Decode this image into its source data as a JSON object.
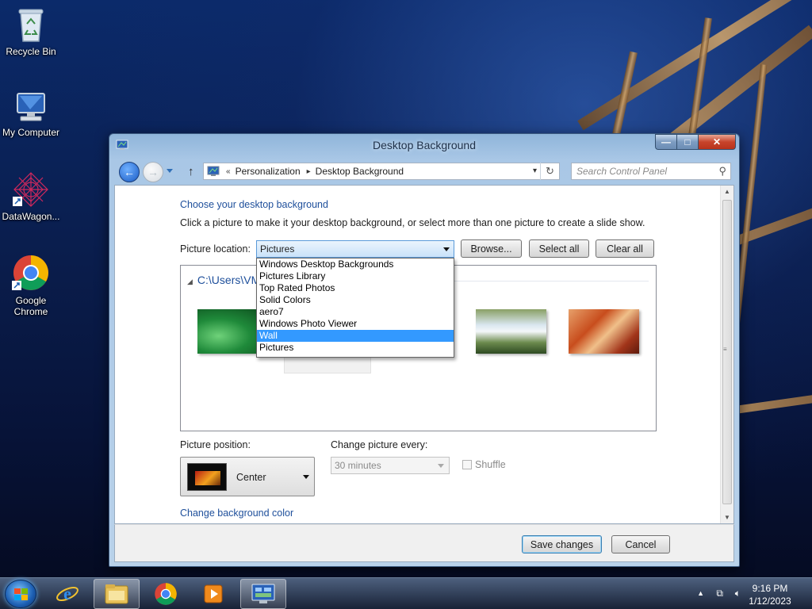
{
  "desktop": {
    "icons": [
      {
        "label": "Recycle Bin"
      },
      {
        "label": "My Computer"
      },
      {
        "label": "DataWagon..."
      },
      {
        "label": "Google Chrome"
      }
    ]
  },
  "window": {
    "title": "Desktop Background",
    "caption_buttons": {
      "minimize": "—",
      "maximize": "□",
      "close": "✕"
    },
    "nav": {
      "back": "←",
      "forward": "→",
      "up": "↑",
      "breadcrumb_prefix": "«",
      "breadcrumbs": [
        "Personalization",
        "Desktop Background"
      ],
      "search_placeholder": "Search Control Panel"
    },
    "content": {
      "heading": "Choose your desktop background",
      "instruction": "Click a picture to make it your desktop background, or select more than one picture to create a slide show.",
      "picture_location_label": "Picture location:",
      "picture_location_value": "Pictures",
      "browse_label": "Browse...",
      "select_all_label": "Select all",
      "clear_all_label": "Clear all",
      "group_path": "C:\\Users\\VM",
      "dropdown_options": [
        "Windows Desktop Backgrounds",
        "Pictures Library",
        "Top Rated Photos",
        "Solid Colors",
        "aero7",
        "Windows Photo Viewer",
        "Wall",
        "Pictures"
      ],
      "highlighted_option": "Wall",
      "picture_position_label": "Picture position:",
      "picture_position_value": "Center",
      "change_every_label": "Change picture every:",
      "change_every_value": "30 minutes",
      "shuffle_label": "Shuffle",
      "change_color_link": "Change background color"
    },
    "footer": {
      "save_label": "Save changes",
      "cancel_label": "Cancel"
    }
  },
  "taskbar": {
    "apps": [
      "start-button",
      "internet-explorer",
      "file-explorer",
      "google-chrome",
      "media-player",
      "control-panel"
    ],
    "time": "9:16 PM",
    "date": "1/12/2023"
  },
  "colors": {
    "link_blue": "#1e4f9b",
    "highlight": "#3399ff",
    "accent_combo": "#5a9ad9"
  }
}
